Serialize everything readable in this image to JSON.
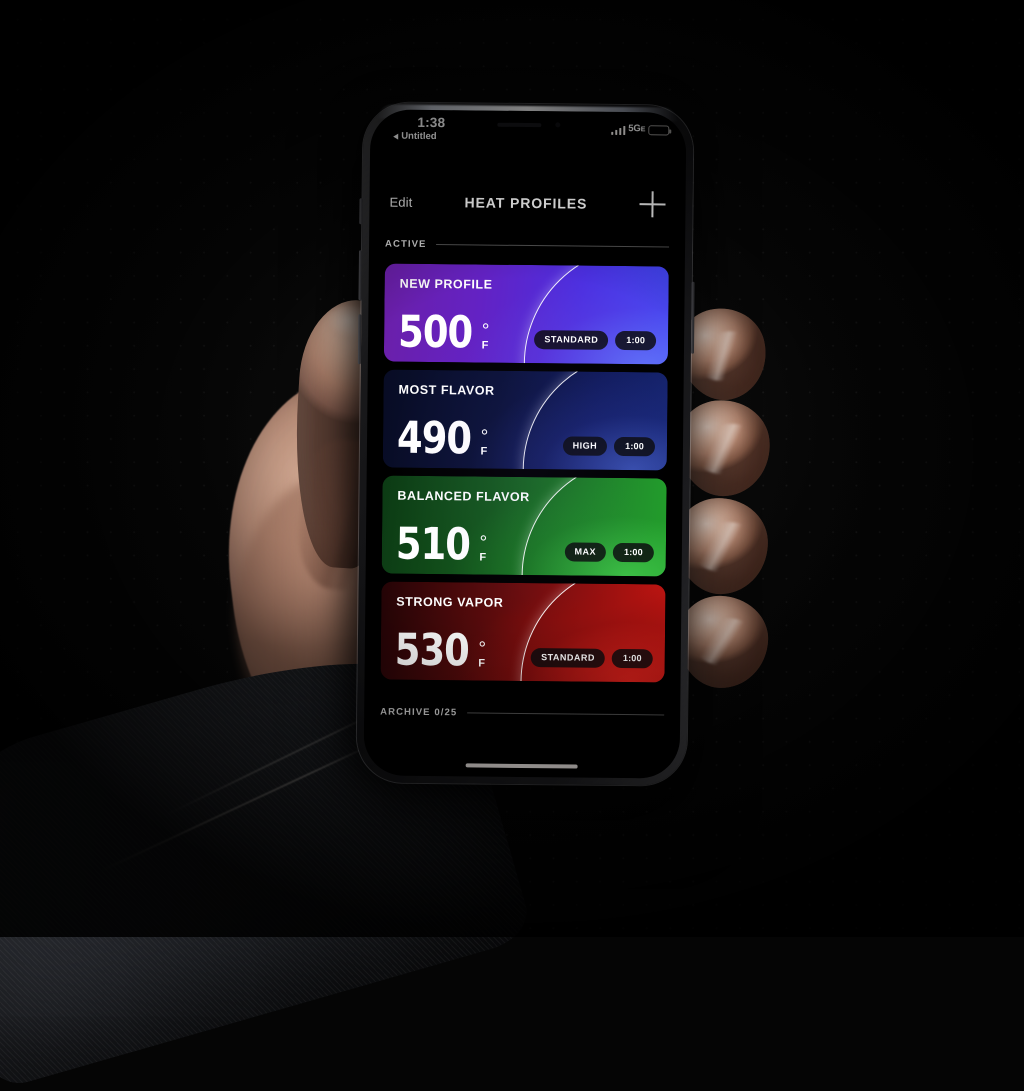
{
  "status_bar": {
    "time": "1:38",
    "back_app_label": "Untitled",
    "back_icon": "back-triangle-icon",
    "signal_icon": "cellular-signal-icon",
    "network_label": "5G",
    "network_suffix": "E",
    "battery_icon": "battery-icon"
  },
  "nav": {
    "edit_label": "Edit",
    "title": "HEAT PROFILES",
    "add_icon": "plus-icon"
  },
  "sections": {
    "active_label": "ACTIVE",
    "archive_label": "ARCHIVE 0/25"
  },
  "profiles": [
    {
      "name": "NEW PROFILE",
      "temperature": "500",
      "degree": "°",
      "scale": "F",
      "mode": "STANDARD",
      "duration": "1:00",
      "accent": "#5b2ad4"
    },
    {
      "name": "MOST FLAVOR",
      "temperature": "490",
      "degree": "°",
      "scale": "F",
      "mode": "HIGH",
      "duration": "1:00",
      "accent": "#111b5c"
    },
    {
      "name": "BALANCED FLAVOR",
      "temperature": "510",
      "degree": "°",
      "scale": "F",
      "mode": "MAX",
      "duration": "1:00",
      "accent": "#1d8026"
    },
    {
      "name": "STRONG VAPOR",
      "temperature": "530",
      "degree": "°",
      "scale": "F",
      "mode": "STANDARD",
      "duration": "1:00",
      "accent": "#93100f"
    }
  ],
  "home_indicator": "home-indicator"
}
